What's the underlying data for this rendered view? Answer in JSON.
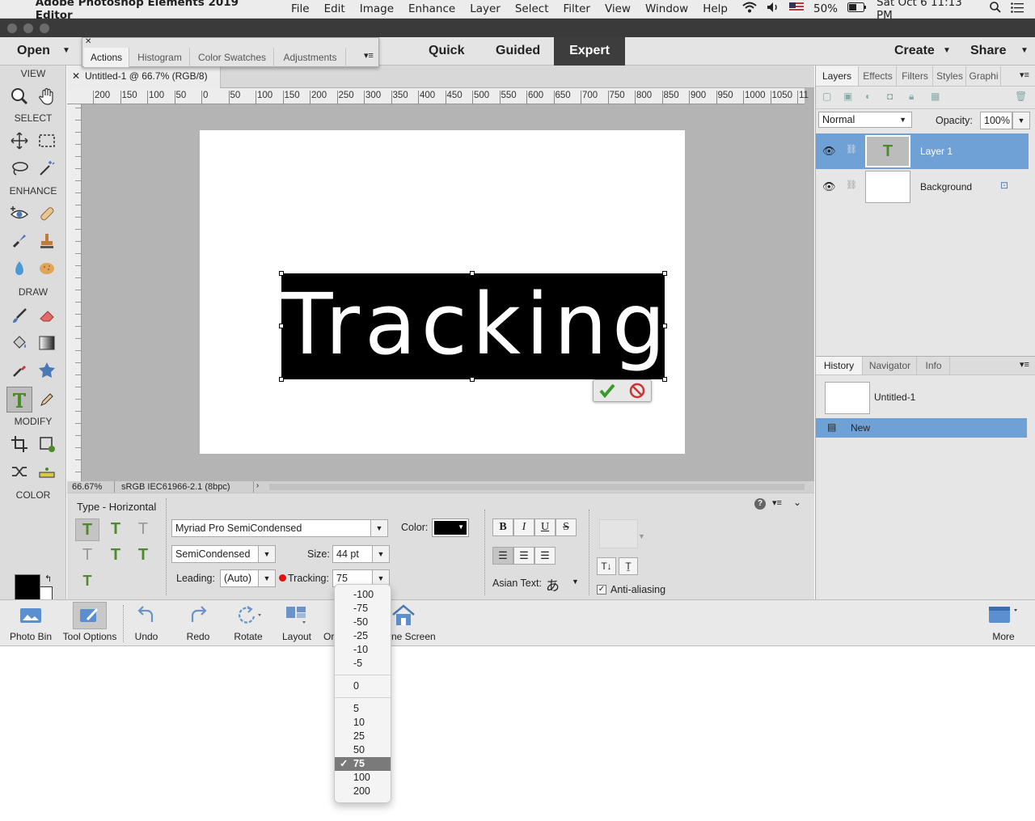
{
  "menubar": {
    "app_name": "Adobe Photoshop Elements 2019 Editor",
    "items": [
      "File",
      "Edit",
      "Image",
      "Enhance",
      "Layer",
      "Select",
      "Filter",
      "View",
      "Window",
      "Help"
    ],
    "battery": "50%",
    "clock": "Sat Oct 6  11:13 PM"
  },
  "toolbar": {
    "open": "Open",
    "modes": [
      "Quick",
      "Guided",
      "Expert"
    ],
    "create": "Create",
    "share": "Share"
  },
  "floating_panel": {
    "tabs": [
      "Actions",
      "Histogram",
      "Color Swatches",
      "Adjustments"
    ]
  },
  "document": {
    "tab_title": "Untitled-1 @ 66.7% (RGB/8)",
    "ruler_labels": [
      "200",
      "150",
      "100",
      "50",
      "0",
      "50",
      "100",
      "150",
      "200",
      "250",
      "300",
      "350",
      "400",
      "450",
      "500",
      "550",
      "600",
      "650",
      "700",
      "750",
      "800",
      "850",
      "900",
      "950",
      "1000",
      "1050",
      "11"
    ],
    "text": "Tracking",
    "zoom": "66.67%",
    "color_profile": "sRGB IEC61966-2.1 (8bpc)"
  },
  "tool_sections": {
    "view": "VIEW",
    "select": "SELECT",
    "enhance": "ENHANCE",
    "draw": "DRAW",
    "modify": "MODIFY",
    "color": "COLOR"
  },
  "layers_panel": {
    "tabs": [
      "Layers",
      "Effects",
      "Filters",
      "Styles",
      "Graphi"
    ],
    "blend_mode": "Normal",
    "opacity_label": "Opacity:",
    "opacity_value": "100%",
    "layers": [
      {
        "name": "Layer 1"
      },
      {
        "name": "Background"
      }
    ]
  },
  "history_panel": {
    "tabs": [
      "History",
      "Navigator",
      "Info"
    ],
    "snapshot": "Untitled-1",
    "steps": [
      "New"
    ]
  },
  "tool_options": {
    "title": "Type - Horizontal",
    "font": "Myriad Pro SemiCondensed",
    "style": "SemiCondensed",
    "size_label": "Size:",
    "size_value": "44 pt",
    "leading_label": "Leading:",
    "leading_value": "(Auto)",
    "tracking_label": "Tracking:",
    "tracking_value": "75",
    "color_label": "Color:",
    "asian_text_label": "Asian Text:",
    "anti_aliasing_label": "Anti-aliasing",
    "bold": "B",
    "italic": "I",
    "underline": "U",
    "strike": "S"
  },
  "tracking_menu": {
    "group1": [
      "-100",
      "-75",
      "-50",
      "-25",
      "-10",
      "-5"
    ],
    "group2": [
      "0"
    ],
    "group3": [
      "5",
      "10",
      "25",
      "50",
      "75",
      "100",
      "200"
    ],
    "selected": "75"
  },
  "bottom_bar": {
    "photo_bin": "Photo Bin",
    "tool_options": "Tool Options",
    "undo": "Undo",
    "redo": "Redo",
    "rotate": "Rotate",
    "layout": "Layout",
    "organizer_partial": "Or",
    "home_partial": "ne Screen",
    "more": "More"
  },
  "colors": {
    "accent_selected": "#6fa0d6",
    "foreground": "#000000",
    "background": "#ffffff"
  }
}
